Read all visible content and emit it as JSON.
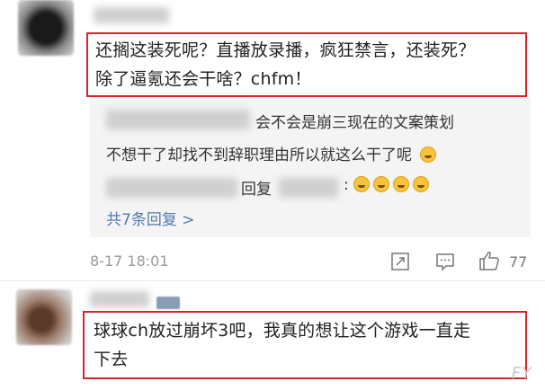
{
  "comment1": {
    "text_line1": "还搁这装死呢？直播放录播，疯狂禁言，还装死？",
    "text_line2": "除了逼氪还会干啥？chfm！"
  },
  "reply": {
    "text_line1": "会不会是崩三现在的文案策划",
    "text_line2": "不想干了却找不到辞职理由所以就这么干了呢",
    "reply_word": "回复",
    "reply_colon": ":",
    "more_replies": "共7条回复 >"
  },
  "meta": {
    "timestamp": "8-17 18:01",
    "like_count": "77"
  },
  "comment2": {
    "text_line1": "球球ch放过崩坏3吧，我真的想让这个游戏一直走",
    "text_line2": "下去"
  },
  "icons": {
    "share": "share-icon",
    "comment": "comment-icon",
    "like": "thumb-up-icon",
    "emoji": "laughing-crying-emoji-icon"
  },
  "colors": {
    "highlight_border": "#d8252c",
    "link_blue": "#507daf",
    "reply_bg": "#f4f4f4"
  }
}
